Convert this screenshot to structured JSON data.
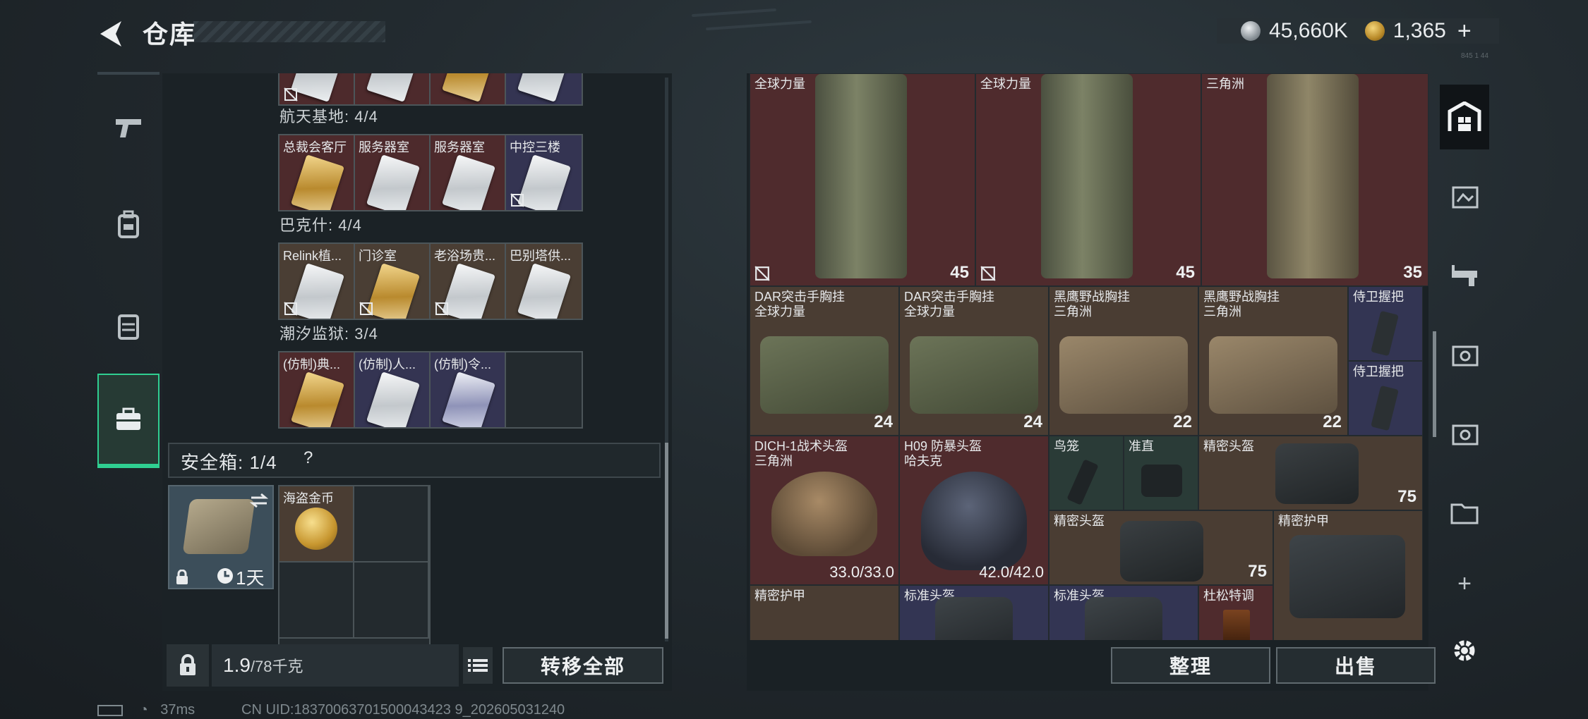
{
  "header": {
    "title": "仓库",
    "currency_silver": "45,660K",
    "currency_gold": "1,365",
    "plus": "+",
    "tiny": "845 1 44"
  },
  "colors": {
    "accent": "#2fcf91",
    "red_rarity": "#4f2b2d",
    "gold_rarity": "#4a3d33",
    "purple_rarity": "#333553",
    "green_rarity": "#2a3b37"
  },
  "tabs": [
    "pistol-icon",
    "backpack-icon",
    "storage-icon",
    "briefcase-icon"
  ],
  "keys": {
    "groups": [
      {
        "title": "航天基地: 4/4",
        "items": [
          {
            "name": "总裁会客厅",
            "rarity": "red",
            "card": "gold"
          },
          {
            "name": "服务器室",
            "rarity": "red",
            "card": "white"
          },
          {
            "name": "服务器室",
            "rarity": "red",
            "card": "white"
          },
          {
            "name": "中控三楼",
            "rarity": "purple",
            "card": "white"
          }
        ]
      },
      {
        "title": "巴克什: 4/4",
        "items": [
          {
            "name": "Relink植...",
            "rarity": "brown",
            "card": "white"
          },
          {
            "name": "门诊室",
            "rarity": "brown",
            "card": "gold"
          },
          {
            "name": "老浴场贵...",
            "rarity": "brown",
            "card": "white"
          },
          {
            "name": "巴别塔供...",
            "rarity": "brown",
            "card": "white"
          }
        ]
      },
      {
        "title": "潮汐监狱: 3/4",
        "items": [
          {
            "name": "(仿制)典...",
            "rarity": "red",
            "card": "gold"
          },
          {
            "name": "(仿制)人...",
            "rarity": "purple",
            "card": "white"
          },
          {
            "name": "(仿制)令...",
            "rarity": "purple",
            "card": "blue"
          },
          {
            "name": "",
            "rarity": "empty",
            "card": ""
          }
        ]
      }
    ]
  },
  "safe": {
    "label": "安全箱:",
    "count": "1/4",
    "help": "?",
    "timer": "1天",
    "coin_item": "海盗金币"
  },
  "bottom_left": {
    "weight": "1.9",
    "weight_max": "/78千克",
    "transfer": "转移全部"
  },
  "right_items": {
    "row1": [
      {
        "name": "全球力量",
        "val": "45"
      },
      {
        "name": "全球力量",
        "val": "45"
      },
      {
        "name": "三角洲",
        "val": "35"
      }
    ],
    "row2": [
      {
        "name": "DAR突击手胸挂\n全球力量",
        "val": "24"
      },
      {
        "name": "DAR突击手胸挂\n全球力量",
        "val": "24"
      },
      {
        "name": "黑鹰野战胸挂\n三角洲",
        "val": "22"
      },
      {
        "name": "黑鹰野战胸挂\n三角洲",
        "val": "22"
      },
      {
        "name": "侍卫握把"
      },
      {
        "name": "侍卫握把"
      }
    ],
    "row3": [
      {
        "name": "DICH-1战术头盔\n三角洲",
        "dur": "33.0/33.0"
      },
      {
        "name": "H09 防暴头盔\n哈夫克",
        "dur": "42.0/42.0"
      },
      {
        "name": "鸟笼"
      },
      {
        "name": "准直"
      },
      {
        "name": "精密头盔",
        "val": "75"
      },
      {
        "name": "精密头盔",
        "val": "75"
      },
      {
        "name": "精密护甲"
      }
    ],
    "row4": [
      {
        "name": "精密护甲"
      },
      {
        "name": "标准头盔"
      },
      {
        "name": "标准头盔"
      },
      {
        "name": "杜松特调"
      }
    ]
  },
  "bottom_right": {
    "sort": "整理",
    "sell": "出售"
  },
  "status": {
    "ping": "37ms",
    "uid": "CN UID:18370063701500043423 9_202605031240"
  }
}
